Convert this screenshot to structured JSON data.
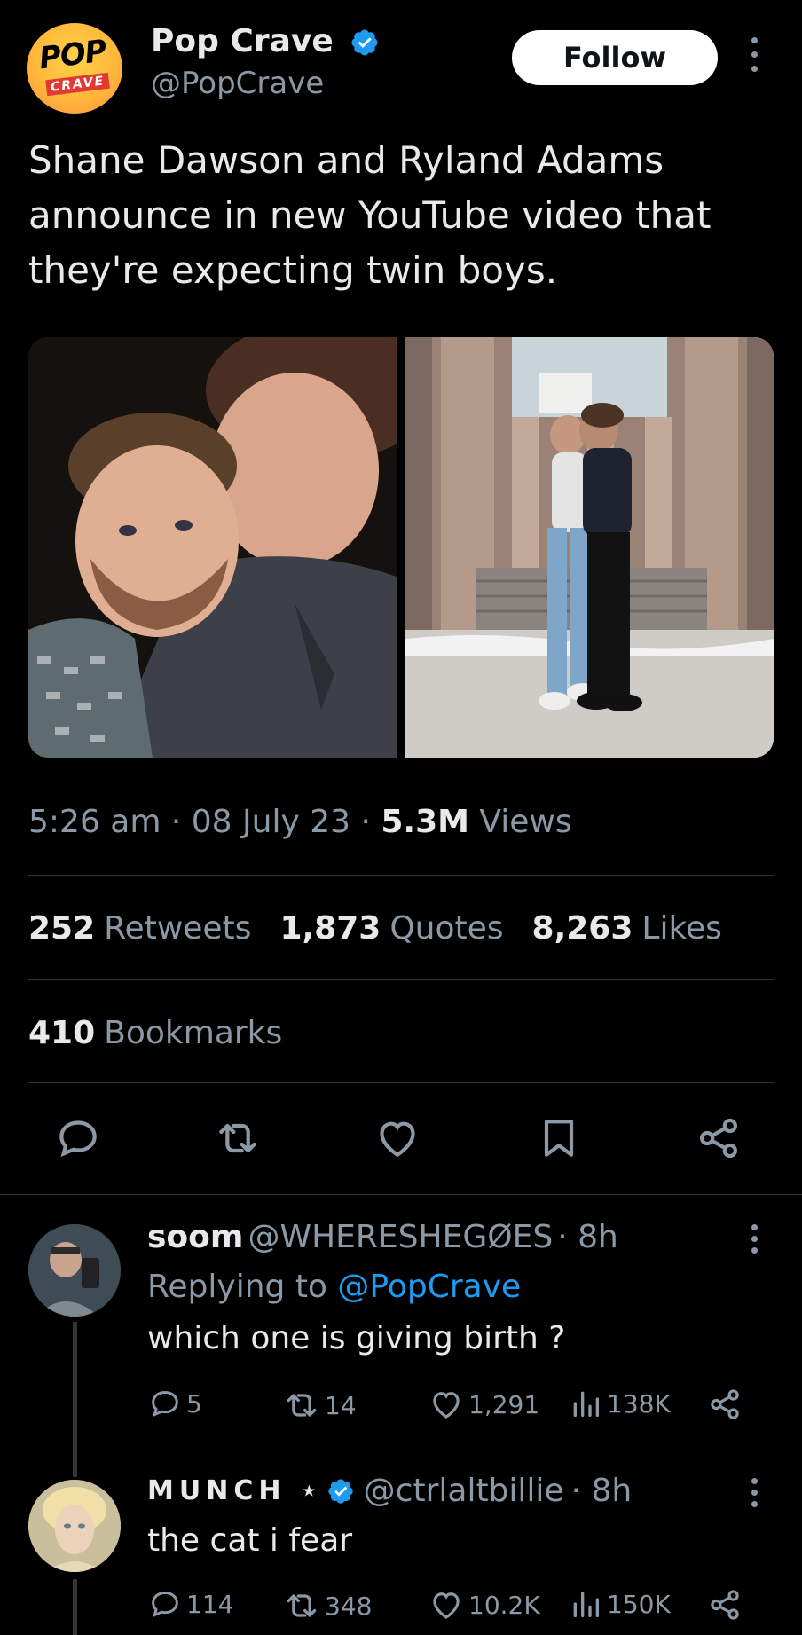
{
  "author": {
    "logo_top": "POP",
    "logo_bottom": "CRAVE",
    "name": "Pop Crave",
    "handle": "@PopCrave"
  },
  "follow_label": "Follow",
  "tweet_text": "Shane Dawson and Ryland Adams announce in new YouTube video that they're expecting twin boys.",
  "meta": {
    "time": "5:26 am",
    "date": "08 July 23",
    "views_count": "5.3M",
    "views_label": "Views"
  },
  "stats": {
    "retweets_count": "252",
    "retweets_label": "Retweets",
    "quotes_count": "1,873",
    "quotes_label": "Quotes",
    "likes_count": "8,263",
    "likes_label": "Likes",
    "bookmarks_count": "410",
    "bookmarks_label": "Bookmarks"
  },
  "replies": [
    {
      "name": "soom",
      "handle": "@WHERESHEGØES",
      "time": "· 8h",
      "replying_prefix": "Replying to",
      "replying_to": "@PopCrave",
      "text": "which one is giving birth ?",
      "replies": "5",
      "retweets": "14",
      "likes": "1,291",
      "views": "138K"
    },
    {
      "name": "MUNCH ⋆",
      "handle": "@ctrlaltbillie",
      "time": "· 8h",
      "text": "the cat i fear",
      "replies": "114",
      "retweets": "348",
      "likes": "10.2K",
      "views": "150K"
    }
  ],
  "colors": {
    "background": "#000000",
    "text": "#e7e9ea",
    "secondary": "#8b98a5",
    "accent": "#1d9bf0",
    "divider": "#2f3336"
  }
}
